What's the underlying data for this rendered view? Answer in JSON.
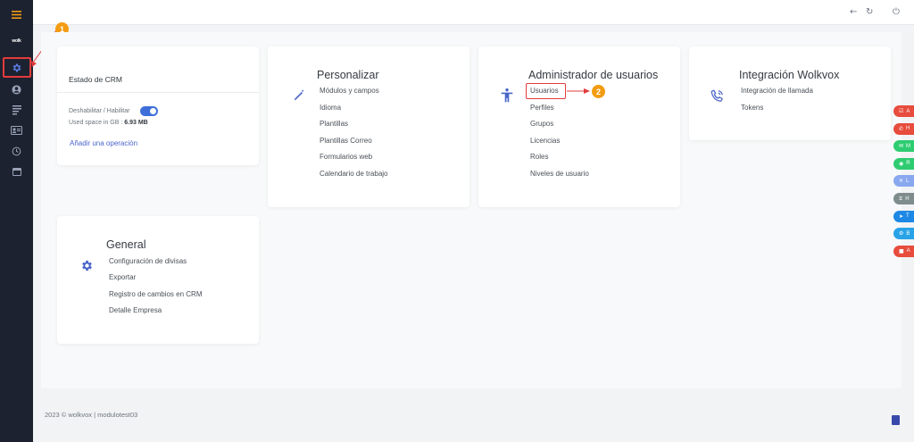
{
  "topbar": {
    "back_icon": "←",
    "refresh_icon": "↻",
    "power_icon": "⏻"
  },
  "sidebar": {
    "logo": "wolk",
    "items": [
      {
        "name": "settings"
      },
      {
        "name": "user"
      },
      {
        "name": "list"
      },
      {
        "name": "contact-card"
      },
      {
        "name": "history"
      },
      {
        "name": "calendar"
      }
    ]
  },
  "badges": {
    "one": "1",
    "two": "2"
  },
  "crm_card": {
    "title": "Estado de CRM",
    "toggle_label": "Deshabilitar / Habilitar",
    "used_space_label": "Used space in GB :",
    "used_space_value": "6.93 MB",
    "add_operation": "Añadir una operación",
    "toggle_enabled": true
  },
  "personalizar": {
    "title": "Personalizar",
    "links": [
      "Módulos y campos",
      "Idioma",
      "Plantillas",
      "Plantillas Correo",
      "Formularios web",
      "Calendario de trabajo"
    ]
  },
  "admin_usuarios": {
    "title": "Administrador de usuarios",
    "links": [
      "Usuarios",
      "Perfiles",
      "Grupos",
      "Licencias",
      "Roles",
      "Niveles de usuario"
    ]
  },
  "integracion": {
    "title": "Integración Wolkvox",
    "links": [
      "Integración de llamada",
      "Tokens"
    ]
  },
  "general": {
    "title": "General",
    "links": [
      "Configuración de divisas",
      "Exportar",
      "Registro de cambios en CRM",
      "Detalle Empresa"
    ]
  },
  "footer": {
    "text": "2023 © wolkvox | modulotest03"
  },
  "floating_buttons": [
    {
      "label": "A",
      "icon": "☑",
      "color": "#e74c3c"
    },
    {
      "label": "H",
      "icon": "✆",
      "color": "#e74c3c"
    },
    {
      "label": "M",
      "icon": "✉",
      "color": "#2ecc71"
    },
    {
      "label": "R",
      "icon": "◉",
      "color": "#2ecc71"
    },
    {
      "label": "L",
      "icon": "✕",
      "color": "#8aa8f0"
    },
    {
      "label": "H",
      "icon": "⧖",
      "color": "#7f8c8d"
    },
    {
      "label": "T",
      "icon": "➤",
      "color": "#1e88e5"
    },
    {
      "label": "B",
      "icon": "⚙",
      "color": "#29a3e8"
    },
    {
      "label": "A",
      "icon": "■",
      "color": "#e74c3c"
    }
  ]
}
